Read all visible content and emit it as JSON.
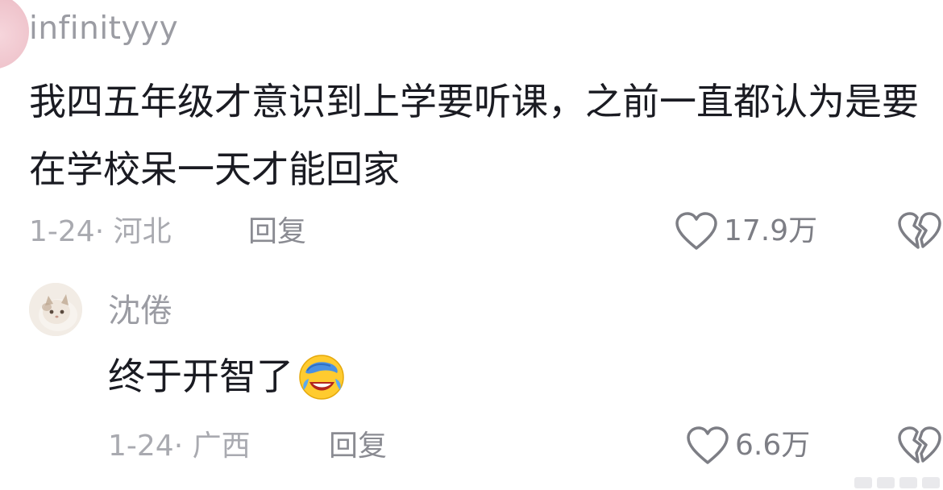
{
  "comments": [
    {
      "username": "infinityyy",
      "text": "我四五年级才意识到上学要听课，之前一直都认为是要在学校呆一天才能回家",
      "date_location": "1-24· 河北",
      "reply_label": "回复",
      "likes": "17.9万"
    },
    {
      "username": "沈倦",
      "text": "终于开智了",
      "emoji": "facepalm-laughing-emoji",
      "date_location": "1-24· 广西",
      "reply_label": "回复",
      "likes": "6.6万"
    }
  ],
  "colors": {
    "username": "#9b9ca3",
    "body_text": "#1a1b22",
    "meta_text": "#a9aab0",
    "icon_stroke": "#7d7e85"
  },
  "icons": [
    "heart-icon",
    "broken-heart-icon"
  ]
}
